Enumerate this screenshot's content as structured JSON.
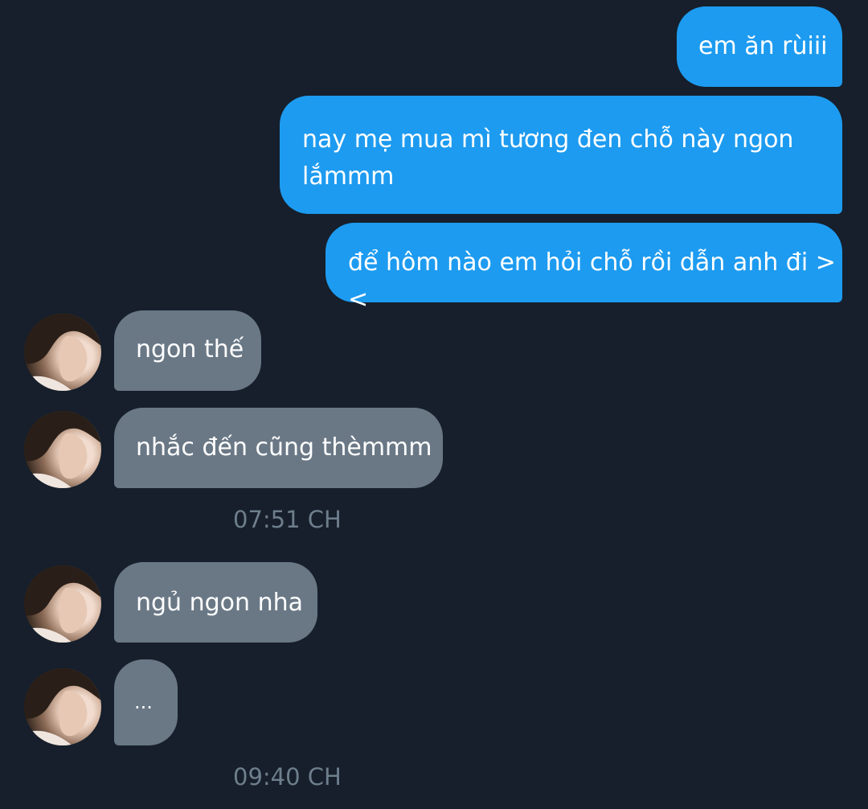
{
  "messages": {
    "sent1": "em ăn rùiii",
    "sent2": "nay mẹ mua mì tương đen chỗ này ngon\nlắmmm",
    "sent3": "để hôm nào em hỏi chỗ rồi dẫn anh đi ><",
    "recv1": "ngon thế",
    "recv2": "nhắc đến cũng thèmmm",
    "recv3": "ngủ ngon nha",
    "recv4": "..."
  },
  "timestamps": {
    "t1": "07:51 CH",
    "t2": "09:40 CH"
  },
  "colors": {
    "background": "#161f2b",
    "sent_bubble": "#1d9bf0",
    "received_bubble": "#6a7886",
    "timestamp": "#6e7e8d"
  }
}
